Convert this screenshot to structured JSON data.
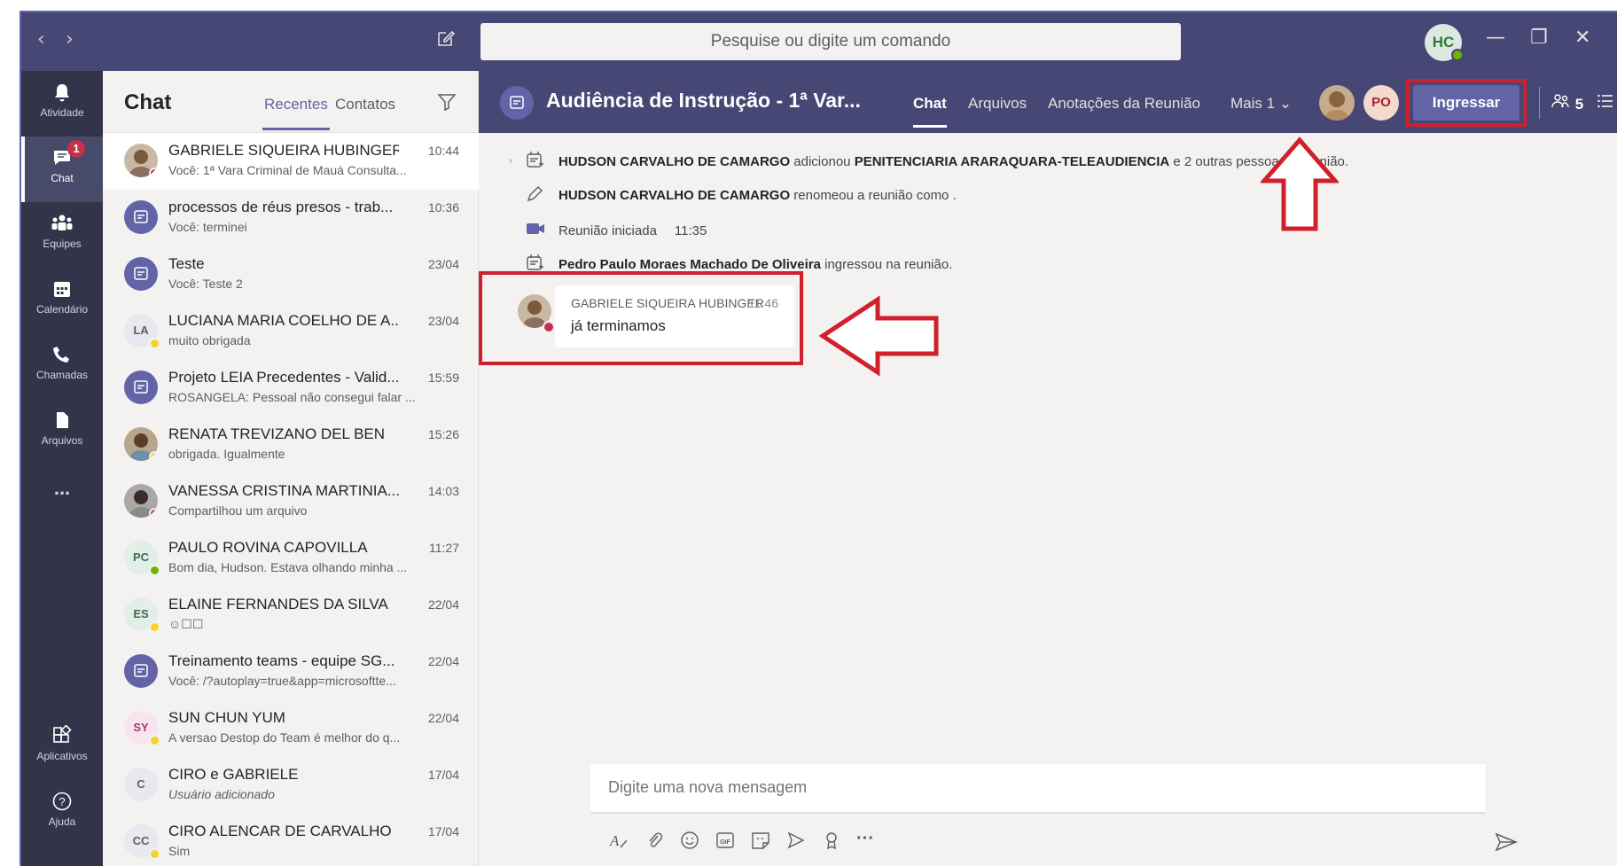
{
  "titlebar": {
    "search_placeholder": "Pesquise ou digite um comando",
    "user_initials": "HC"
  },
  "rail": {
    "items": [
      {
        "label": "Atividade",
        "icon": "bell-icon"
      },
      {
        "label": "Chat",
        "icon": "chat-icon",
        "badge": "1"
      },
      {
        "label": "Equipes",
        "icon": "teams-icon"
      },
      {
        "label": "Calendário",
        "icon": "calendar-icon"
      },
      {
        "label": "Chamadas",
        "icon": "phone-icon"
      },
      {
        "label": "Arquivos",
        "icon": "files-icon"
      },
      {
        "label": "...",
        "icon": "more-icon"
      }
    ],
    "bottom": [
      {
        "label": "Aplicativos",
        "icon": "apps-icon"
      },
      {
        "label": "Ajuda",
        "icon": "help-icon"
      }
    ]
  },
  "chatlist": {
    "title": "Chat",
    "tabs": [
      "Recentes",
      "Contatos"
    ],
    "conversations": [
      {
        "name": "GABRIELE SIQUEIRA HUBINGER",
        "preview": "Você: 1ª Vara Criminal de Mauá Consulta...",
        "time": "10:44",
        "avatar": "photo",
        "status": "busy"
      },
      {
        "name": "processos de réus presos - trab...",
        "preview": "Você: terminei",
        "time": "10:36",
        "avatar": "meeting"
      },
      {
        "name": "Teste",
        "preview": "Você: Teste 2",
        "time": "23/04",
        "avatar": "meeting"
      },
      {
        "name": "LUCIANA MARIA COELHO DE A...",
        "preview": "muito obrigada",
        "time": "23/04",
        "avatar": "LA",
        "status": "away"
      },
      {
        "name": "Projeto LEIA Precedentes - Valid...",
        "preview": "ROSANGELA: Pessoal não consegui falar ...",
        "time": "15:59",
        "avatar": "meeting"
      },
      {
        "name": "RENATA TREVIZANO DEL BEN",
        "preview": "obrigada. Igualmente",
        "time": "15:26",
        "avatar": "photo",
        "status": "away"
      },
      {
        "name": "VANESSA CRISTINA MARTINIA...",
        "preview": "Compartilhou um arquivo",
        "time": "14:03",
        "avatar": "photo",
        "status": "busy"
      },
      {
        "name": "PAULO ROVINA CAPOVILLA",
        "preview": "Bom dia, Hudson. Estava olhando minha ...",
        "time": "11:27",
        "avatar": "PC",
        "status": "ok"
      },
      {
        "name": "ELAINE FERNANDES DA SILVA",
        "preview": "☺☐☐",
        "time": "22/04",
        "avatar": "ES",
        "status": "away"
      },
      {
        "name": "Treinamento teams - equipe SG...",
        "preview": "Você: /?autoplay=true&app=microsoftte...",
        "time": "22/04",
        "avatar": "meeting"
      },
      {
        "name": "SUN CHUN YUM",
        "preview": "A versao Destop do Team é melhor do q...",
        "time": "22/04",
        "avatar": "SY",
        "status": "away"
      },
      {
        "name": "CIRO e GABRIELE",
        "preview": "Usuário adicionado",
        "time": "17/04",
        "avatar": "C",
        "italic": true
      },
      {
        "name": "CIRO ALENCAR DE CARVALHO",
        "preview": "Sim",
        "time": "17/04",
        "avatar": "CC",
        "status": "away"
      }
    ]
  },
  "meeting": {
    "title": "Audiência de Instrução - 1ª Var...",
    "tabs": [
      "Chat",
      "Arquivos",
      "Anotações da Reunião",
      "Mais 1"
    ],
    "participant_initials": "PO",
    "join_label": "Ingressar",
    "participant_count": "5"
  },
  "messages": {
    "system": [
      {
        "bold": "HUDSON CARVALHO DE CAMARGO",
        "text": " adicionou ",
        "bold2": "PENITENCIARIA ARARAQUARA-TELEAUDIENCIA",
        "text2": " e 2 outras pessoas à reunião."
      },
      {
        "bold": "HUDSON CARVALHO DE CAMARGO",
        "text": " renomeou a reunião como ."
      },
      {
        "text": "Reunião iniciada",
        "time": "11:35"
      },
      {
        "bold": "Pedro Paulo Moraes Machado De Oliveira",
        "text": " ingressou na reunião."
      }
    ],
    "post": {
      "author": "GABRIELE SIQUEIRA HUBINGER",
      "time": "11:46",
      "text": "já terminamos"
    }
  },
  "compose": {
    "placeholder": "Digite uma nova mensagem"
  },
  "colors": {
    "accent": "#6264a7",
    "header": "#464775",
    "rail": "#33344a",
    "highlight": "#d0202b"
  }
}
